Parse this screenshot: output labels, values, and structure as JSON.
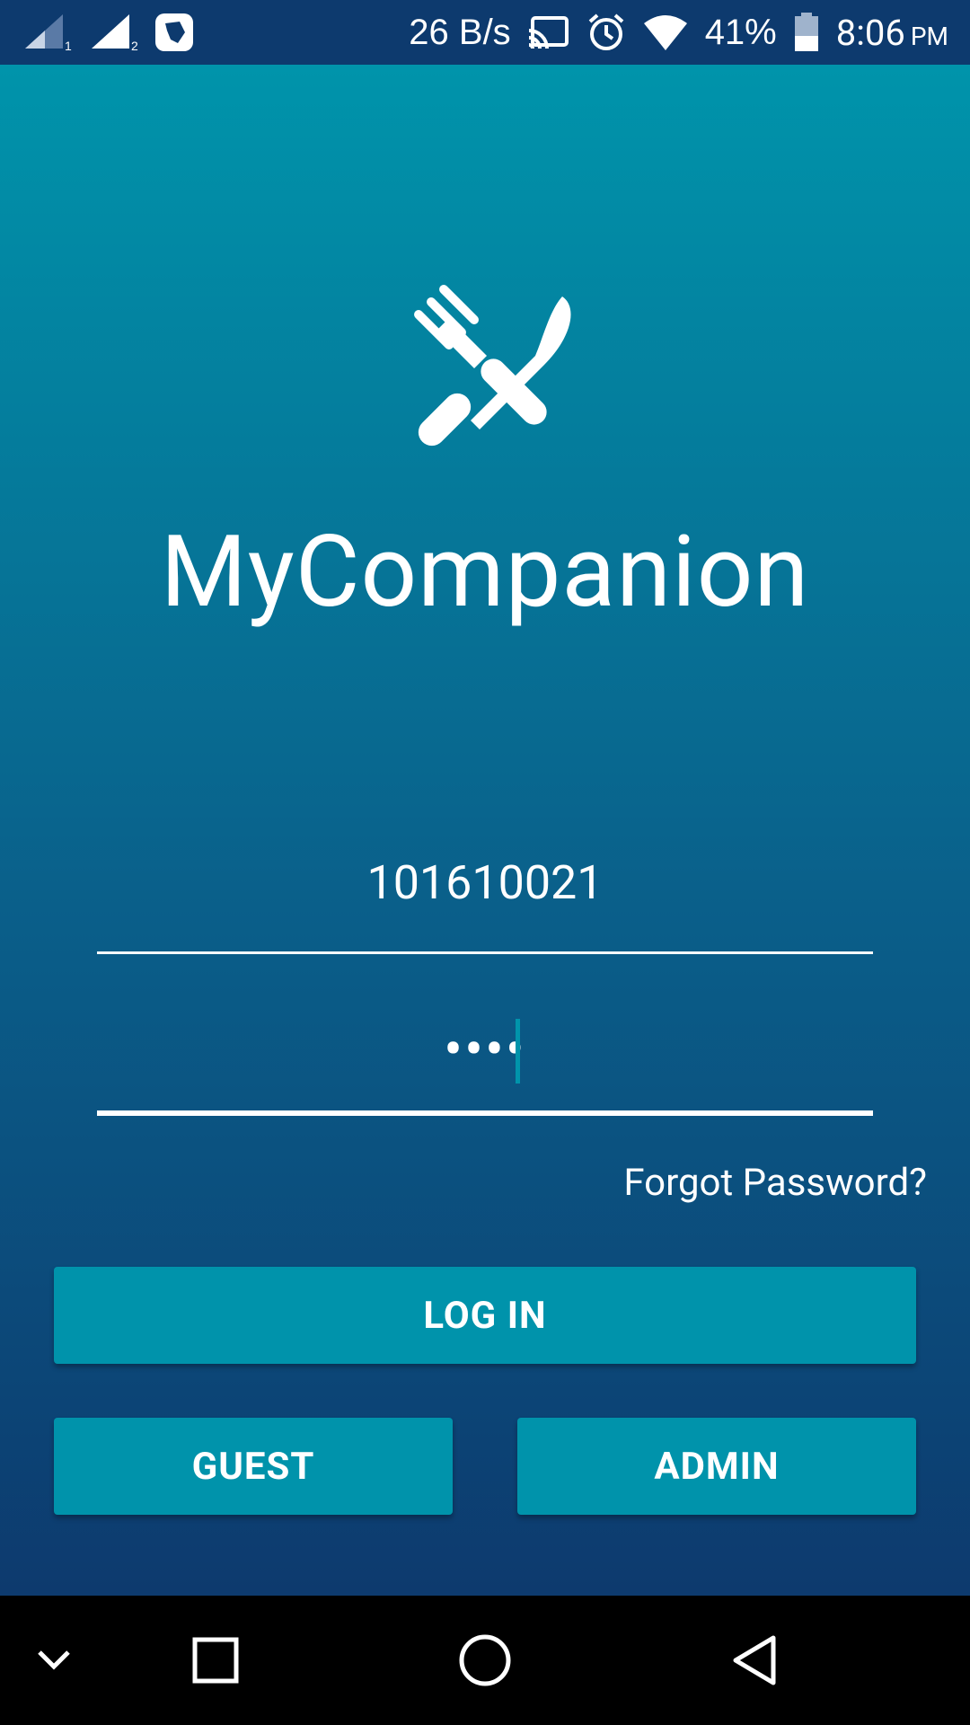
{
  "status_bar": {
    "network_speed": "26 B/s",
    "battery_percent": "41%",
    "time": "8:06",
    "ampm": "PM",
    "sim1_label": "1",
    "sim2_label": "2",
    "icons": [
      "signal-sim1-icon",
      "signal-sim2-icon",
      "app-notification-icon",
      "cast-icon",
      "alarm-icon",
      "wifi-icon",
      "battery-icon"
    ]
  },
  "app": {
    "logo_icon": "fork-knife-icon",
    "title": "MyCompanion"
  },
  "login_form": {
    "username_value": "101610021",
    "password_masked": "••••",
    "forgot_password": "Forgot Password?",
    "login_button": "LOG IN",
    "guest_button": "GUEST",
    "admin_button": "ADMIN"
  },
  "nav_bar": {
    "icons": [
      "chevron-down-icon",
      "recents-square-icon",
      "home-circle-icon",
      "back-triangle-icon"
    ]
  },
  "colors": {
    "status_bar": "#0d3a6e",
    "gradient_top": "#0094ab",
    "gradient_bottom": "#0d3a6e",
    "button": "#0093ab",
    "nav_bar": "#000000"
  }
}
